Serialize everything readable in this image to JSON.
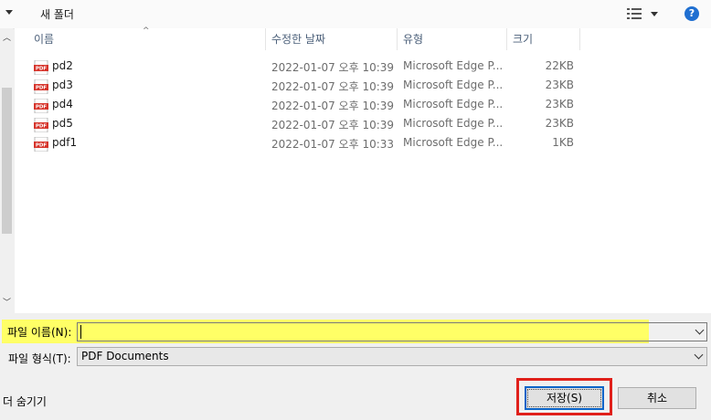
{
  "toolbar": {
    "new_folder": "새 폴더",
    "help": "?"
  },
  "columns": {
    "name": "이름",
    "date": "수정한 날짜",
    "type": "유형",
    "size": "크기"
  },
  "files": [
    {
      "name": "pd2",
      "date": "2022-01-07 오후 10:39",
      "type": "Microsoft Edge P...",
      "size": "22KB"
    },
    {
      "name": "pd3",
      "date": "2022-01-07 오후 10:39",
      "type": "Microsoft Edge P...",
      "size": "23KB"
    },
    {
      "name": "pd4",
      "date": "2022-01-07 오후 10:39",
      "type": "Microsoft Edge P...",
      "size": "23KB"
    },
    {
      "name": "pd5",
      "date": "2022-01-07 오후 10:39",
      "type": "Microsoft Edge P...",
      "size": "23KB"
    },
    {
      "name": "pdf1",
      "date": "2022-01-07 오후 10:33",
      "type": "Microsoft Edge P...",
      "size": "1KB"
    }
  ],
  "file_icon_text": "PDF",
  "filename": {
    "label": "파일 이름(N):",
    "value": ""
  },
  "filetype": {
    "label": "파일 형식(T):",
    "value": "PDF Documents"
  },
  "hide_folders": "더 숨기기",
  "buttons": {
    "save": "저장(S)",
    "cancel": "취소"
  },
  "colors": {
    "highlight": "#ffff66",
    "annotation_box": "#e0201b",
    "pdf_red": "#d6332a"
  }
}
